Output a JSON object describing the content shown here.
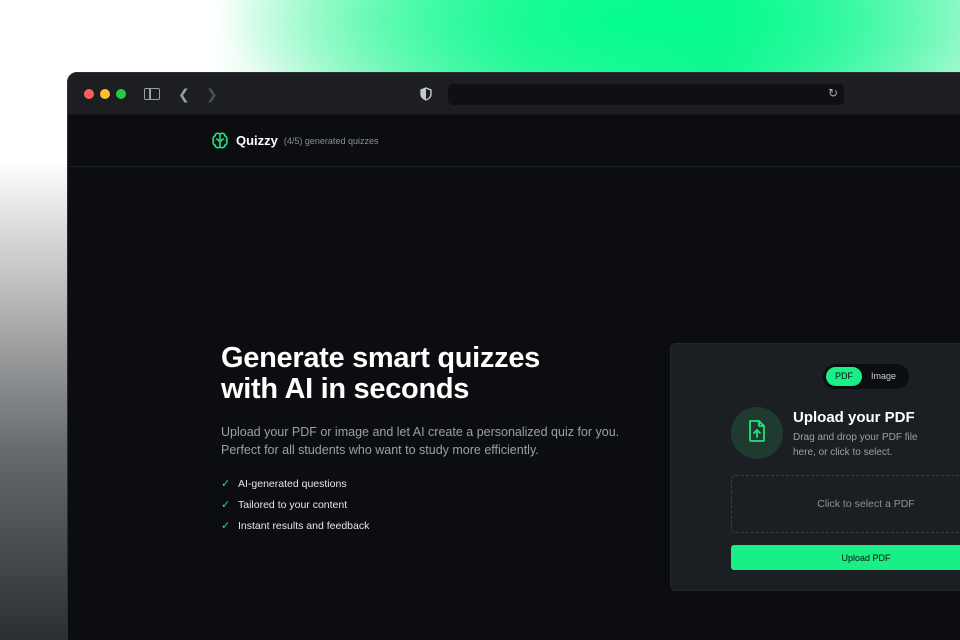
{
  "header": {
    "brand": "Quizzy",
    "quota": "(4/5) generated quizzes"
  },
  "hero": {
    "title_line1": "Generate smart quizzes",
    "title_line2": "with AI in seconds",
    "description": "Upload your PDF or image and let AI create a personalized quiz for you. Perfect for all students who want to study more efficiently.",
    "features": [
      "AI-generated questions",
      "Tailored to your content",
      "Instant results and feedback"
    ]
  },
  "upload_card": {
    "toggle_options": [
      "PDF",
      "Image"
    ],
    "selected_option": "PDF",
    "title": "Upload your PDF",
    "description": "Drag and drop your PDF file here, or click to select.",
    "dropzone_text": "Click to select a PDF",
    "button_label": "Upload PDF"
  },
  "colors": {
    "accent": "#18ef85",
    "background": "#0b0d10",
    "card": "#1b1e22"
  },
  "icons": [
    "sidebar-icon",
    "back-icon",
    "forward-icon",
    "shield-icon",
    "reload-icon",
    "brain-logo-icon",
    "check-icon",
    "file-upload-icon"
  ]
}
